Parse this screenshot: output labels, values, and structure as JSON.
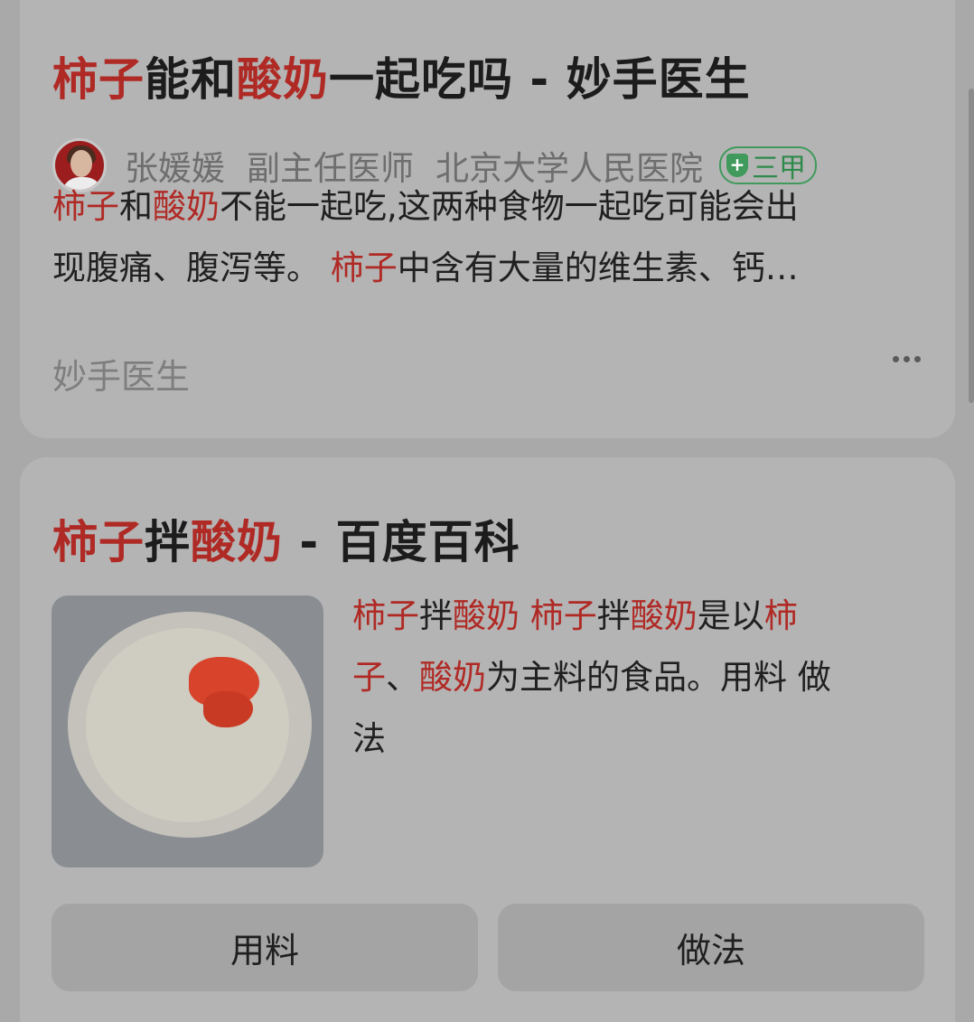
{
  "result1": {
    "title": [
      {
        "text": "柿子",
        "hl": true
      },
      {
        "text": "能和",
        "hl": false
      },
      {
        "text": "酸奶",
        "hl": true
      },
      {
        "text": "一起吃吗 - 妙手医生",
        "hl": false
      }
    ],
    "doctor": {
      "name": "张媛媛",
      "title": "副主任医师",
      "hospital": "北京大学人民医院",
      "badge": "三甲"
    },
    "snippet_line1": [
      {
        "text": "柿子",
        "hl": true
      },
      {
        "text": "和",
        "hl": false
      },
      {
        "text": "酸奶",
        "hl": true
      },
      {
        "text": "不能一起吃,这两种食物一起吃可能会出",
        "hl": false
      }
    ],
    "snippet_line2": [
      {
        "text": "现腹痛、腹泻等。 ",
        "hl": false
      },
      {
        "text": "柿子",
        "hl": true
      },
      {
        "text": "中含有大量的维生素、钙…",
        "hl": false
      }
    ],
    "source": "妙手医生"
  },
  "result2": {
    "title": [
      {
        "text": "柿子",
        "hl": true
      },
      {
        "text": "拌",
        "hl": false
      },
      {
        "text": "酸奶",
        "hl": true
      },
      {
        "text": " - 百度百科",
        "hl": false
      }
    ],
    "desc_line1": [
      {
        "text": "柿子",
        "hl": true
      },
      {
        "text": "拌",
        "hl": false
      },
      {
        "text": "酸奶",
        "hl": true
      },
      {
        "text": " ",
        "hl": false
      },
      {
        "text": "柿子",
        "hl": true
      },
      {
        "text": "拌",
        "hl": false
      },
      {
        "text": "酸奶",
        "hl": true
      },
      {
        "text": "是以",
        "hl": false
      },
      {
        "text": "柿",
        "hl": true
      }
    ],
    "desc_line2": [
      {
        "text": "子",
        "hl": true
      },
      {
        "text": "、",
        "hl": false
      },
      {
        "text": "酸奶",
        "hl": true
      },
      {
        "text": "为主料的食品。用料 做",
        "hl": false
      }
    ],
    "desc_line3": [
      {
        "text": "法",
        "hl": false
      }
    ],
    "buttons": [
      "用料",
      "做法"
    ]
  },
  "colors": {
    "highlight": "#b02a25",
    "badge_green": "#3f9a5c",
    "card_bg": "#b4b4b4",
    "page_bg": "#a9a9a9"
  }
}
